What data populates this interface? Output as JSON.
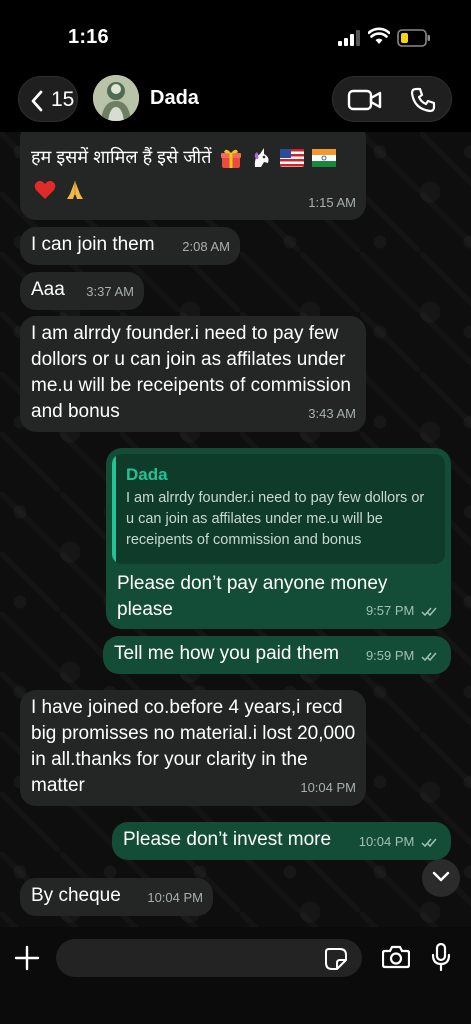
{
  "status_bar": {
    "time": "1:16"
  },
  "header": {
    "back_count": "15",
    "contact_name": "Dada",
    "icons": [
      "chevron-left-icon",
      "video-call-icon",
      "phone-call-icon"
    ]
  },
  "messages": [
    {
      "direction": "in",
      "text": "हम इसमें शामिल हैं इसे जीतें 🎁🦄🇺🇸🇮🇳\n❤️🙏",
      "line1": "हम इसमें शामिल हैं इसे जीतें",
      "line2": "",
      "time": "1:15 AM"
    },
    {
      "direction": "in",
      "text": "I can join them",
      "time": "2:08 AM"
    },
    {
      "direction": "in",
      "text": "Aaa",
      "time": "3:37 AM"
    },
    {
      "direction": "in",
      "text": "I am alrrdy founder.i need to pay few dollors or u can join as affilates under me.u will be receipents of commission and bonus",
      "time": "3:43 AM"
    },
    {
      "direction": "out",
      "quote_name": "Dada",
      "quote_text": "I am alrrdy founder.i need to pay few dollors or u can join as affilates under me.u will be receipents of commission and bonus",
      "text": "Please don’t pay anyone money please",
      "time": "9:57 PM"
    },
    {
      "direction": "out",
      "text": "Tell me how you paid them",
      "time": "9:59 PM"
    },
    {
      "direction": "in",
      "text": "I have joined co.before 4 years,i recd big promisses no material.i lost 20,000 in all.thanks for your clarity in the matter",
      "time": "10:04 PM"
    },
    {
      "direction": "out",
      "text": "Please don’t invest more",
      "time": "10:04 PM"
    },
    {
      "direction": "in",
      "text": "By cheque",
      "time": "10:04 PM"
    }
  ],
  "composer": {
    "value": "",
    "placeholder": ""
  },
  "colors": {
    "incoming": "#242626",
    "outgoing": "#144d37",
    "accent": "#25c194"
  }
}
